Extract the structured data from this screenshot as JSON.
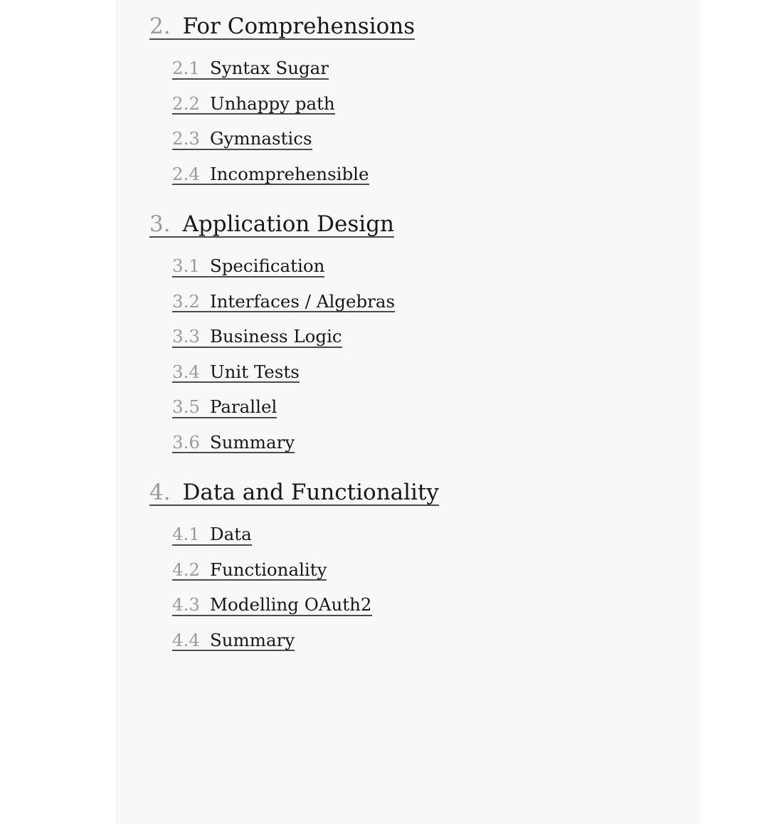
{
  "document": {
    "type": "table-of-contents",
    "background_color": "#ffffff",
    "panel_color": "#f8f8f8",
    "number_color": "#9a9a9a",
    "title_color": "#171717",
    "underline_color": "#4a4a4a"
  },
  "toc": {
    "entries": [
      {
        "number": "2.",
        "title": "For Comprehensions",
        "level": 1
      },
      {
        "number": "2.1",
        "title": "Syntax Sugar",
        "level": 2
      },
      {
        "number": "2.2",
        "title": "Unhappy path",
        "level": 2
      },
      {
        "number": "2.3",
        "title": "Gymnastics",
        "level": 2
      },
      {
        "number": "2.4",
        "title": "Incomprehensible",
        "level": 2
      },
      {
        "number": "3.",
        "title": "Application Design",
        "level": 1
      },
      {
        "number": "3.1",
        "title": "Specification",
        "level": 2
      },
      {
        "number": "3.2",
        "title": "Interfaces / Algebras",
        "level": 2
      },
      {
        "number": "3.3",
        "title": "Business Logic",
        "level": 2
      },
      {
        "number": "3.4",
        "title": "Unit Tests",
        "level": 2
      },
      {
        "number": "3.5",
        "title": "Parallel",
        "level": 2
      },
      {
        "number": "3.6",
        "title": "Summary",
        "level": 2
      },
      {
        "number": "4.",
        "title": "Data and Functionality",
        "level": 1
      },
      {
        "number": "4.1",
        "title": "Data",
        "level": 2
      },
      {
        "number": "4.2",
        "title": "Functionality",
        "level": 2
      },
      {
        "number": "4.3",
        "title": "Modelling OAuth2",
        "level": 2
      },
      {
        "number": "4.4",
        "title": "Summary",
        "level": 2
      }
    ]
  }
}
